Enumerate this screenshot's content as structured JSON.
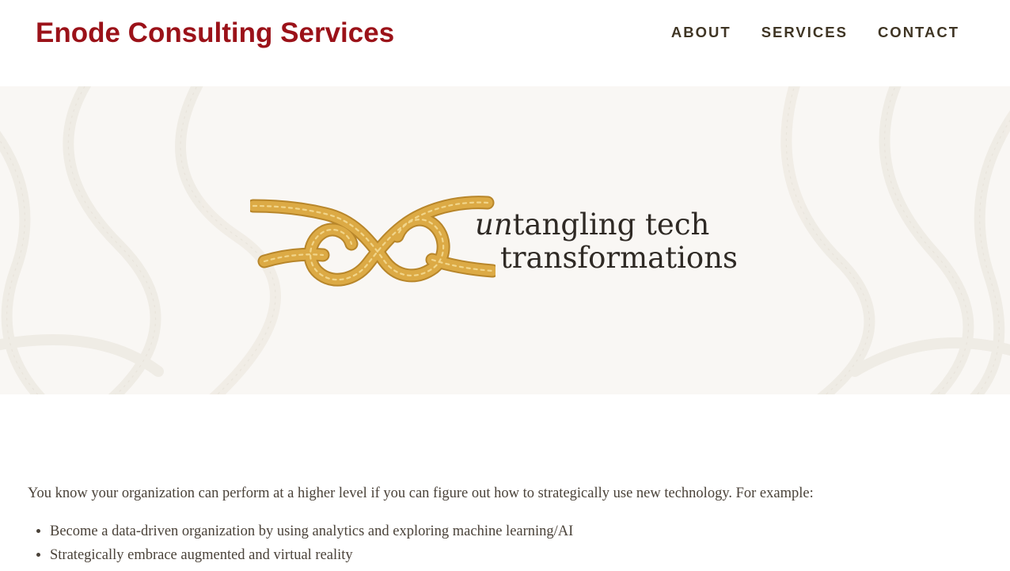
{
  "header": {
    "site_title": "Enode Consulting Services",
    "nav": [
      {
        "label": "ABOUT"
      },
      {
        "label": "SERVICES"
      },
      {
        "label": "CONTACT"
      }
    ]
  },
  "hero": {
    "tagline_emphasis": "un",
    "tagline_line1_rest": "tangling tech",
    "tagline_line2": "transformations",
    "logo_icon": "rope-knot-icon",
    "background_pattern": "rope-pattern",
    "colors": {
      "background": "#f9f7f4",
      "rope": "#d9a63a",
      "tagline": "#2f2a25"
    }
  },
  "content": {
    "intro": "You know your organization can perform at a higher level if you can figure out how to strategically use new technology. For example:",
    "examples": [
      "Become a data-driven organization by using analytics and exploring machine learning/AI",
      "Strategically embrace augmented and virtual reality"
    ]
  },
  "colors": {
    "brand": "#9b1219",
    "nav_text": "#3f3524",
    "body_text": "#4a4239"
  }
}
